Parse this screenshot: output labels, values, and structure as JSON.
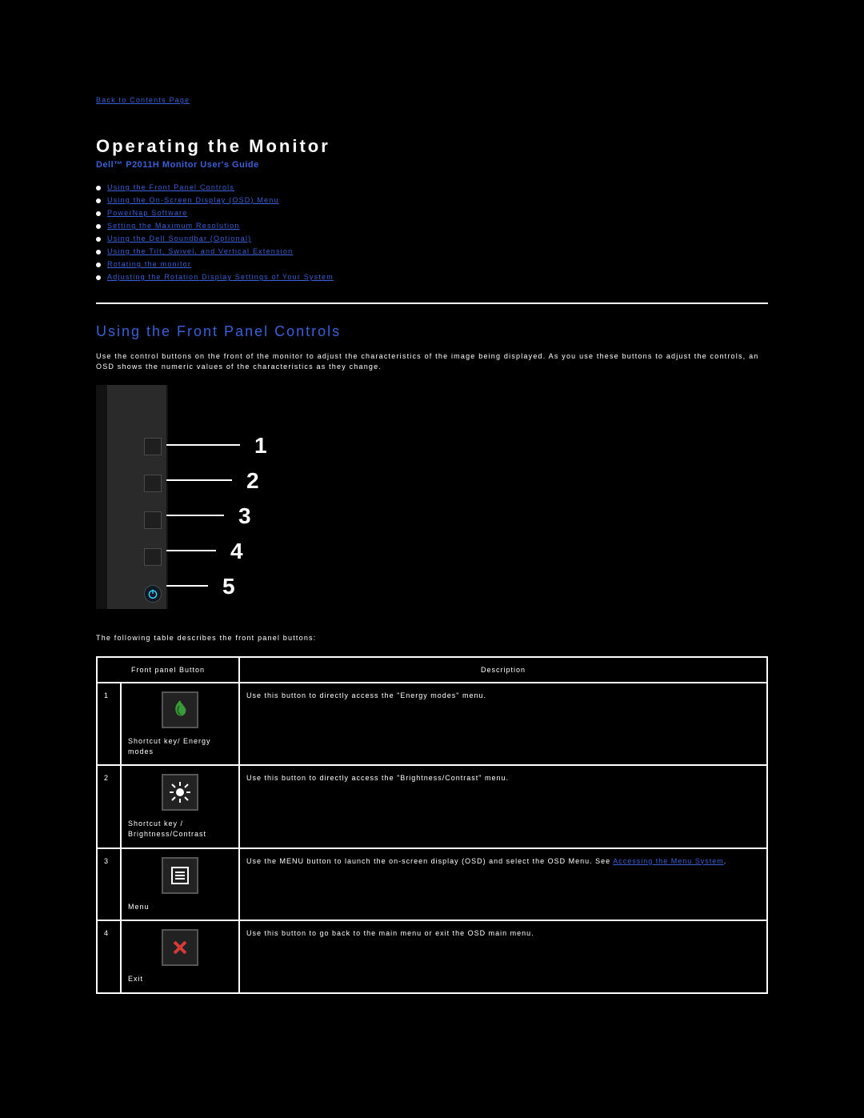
{
  "back_link": "Back to Contents Page",
  "title": "Operating the Monitor",
  "subtitle": "Dell™ P2011H Monitor User's Guide",
  "toc": [
    "Using the Front Panel Controls",
    "Using the On-Screen Display (OSD) Menu",
    "PowerNap Software",
    "Setting the Maximum Resolution",
    "Using the Dell Soundbar (Optional)",
    "Using the Tilt, Swivel, and Vertical Extension",
    "Rotating the monitor",
    "Adjusting the Rotation Display Settings of Your System"
  ],
  "section_heading": "Using the Front Panel Controls",
  "intro_text": "Use the control buttons on the front of the monitor to adjust the characteristics of the image being displayed. As you use these buttons to adjust the controls, an OSD shows the numeric values of the characteristics as they change.",
  "diagram_numbers": [
    "1",
    "2",
    "3",
    "4",
    "5"
  ],
  "table_caption": "The following table describes the front panel buttons:",
  "table_headers": {
    "col1": "Front panel Button",
    "col2": "Description"
  },
  "rows": [
    {
      "idx": "1",
      "icon": "energy",
      "label": "Shortcut key/ Energy modes",
      "desc": "Use this button to directly access the \"Energy modes\" menu."
    },
    {
      "idx": "2",
      "icon": "brightness",
      "label": "Shortcut key / Brightness/Contrast",
      "desc": "Use this button to directly access the \"Brightness/Contrast\" menu."
    },
    {
      "idx": "3",
      "icon": "menu",
      "label": "Menu",
      "desc_pre": "Use the MENU button to launch the on-screen display (OSD) and select the OSD Menu. See ",
      "desc_link": "Accessing the Menu System",
      "desc_post": "."
    },
    {
      "idx": "4",
      "icon": "exit",
      "label": "Exit",
      "desc": "Use this button to go back to the main menu or exit the OSD main menu."
    }
  ]
}
